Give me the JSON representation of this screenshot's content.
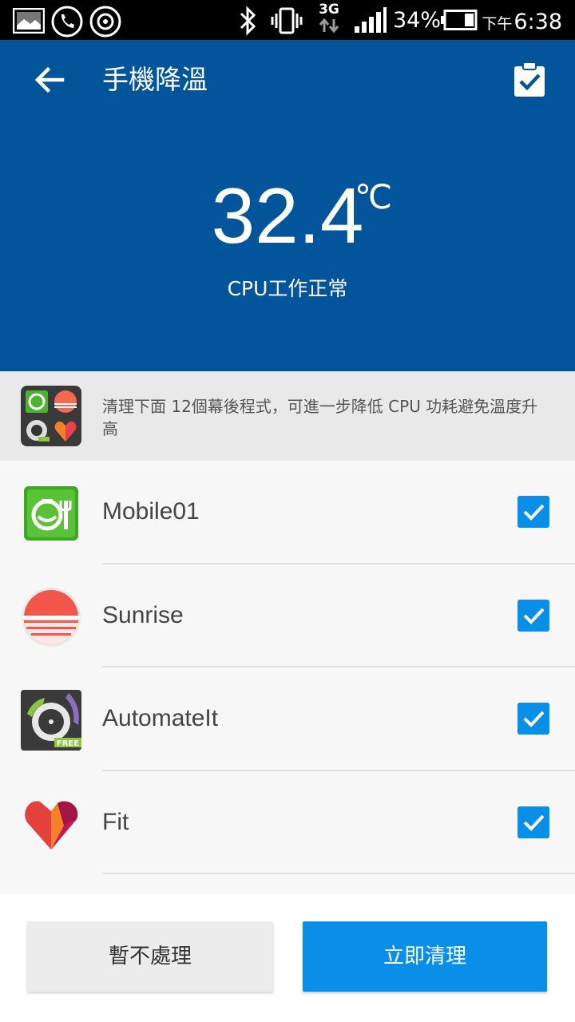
{
  "status_bar": {
    "battery_percent": "34%",
    "network": "3G",
    "time_prefix": "下午",
    "time": "6:38"
  },
  "header": {
    "title": "手機降溫",
    "temperature": "32.4",
    "unit": "℃",
    "status": "CPU工作正常"
  },
  "banner": {
    "text": "清理下面 12個幕後程式，可進一步降低 CPU 功耗避免溫度升高"
  },
  "apps": [
    {
      "name": "Mobile01",
      "icon": "mobile01-icon",
      "checked": true
    },
    {
      "name": "Sunrise",
      "icon": "sunrise-icon",
      "checked": true
    },
    {
      "name": "AutomateIt",
      "icon": "automateit-icon",
      "checked": true,
      "badge": "FREE"
    },
    {
      "name": "Fit",
      "icon": "fit-icon",
      "checked": true
    }
  ],
  "buttons": {
    "later": "暫不處理",
    "clean_now": "立即清理"
  },
  "colors": {
    "header_bg": "#02549b",
    "accent": "#0a8fe9"
  }
}
